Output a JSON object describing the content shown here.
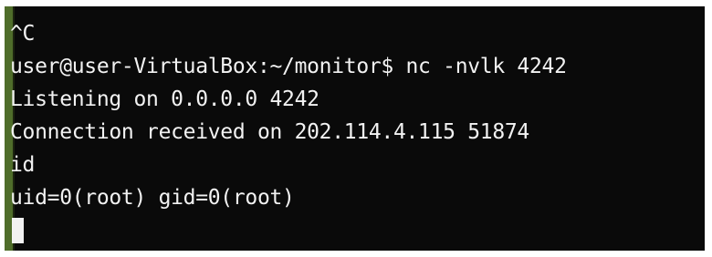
{
  "terminal": {
    "lines": [
      "^C",
      "user@user-VirtualBox:~/monitor$ nc -nvlk 4242",
      "Listening on 0.0.0.0 4242",
      "Connection received on 202.114.4.115 51874",
      "id",
      "uid=0(root) gid=0(root)"
    ],
    "colors": {
      "background": "#0a0a0a",
      "text": "#f2f2f2",
      "left_bar": "#4f6d2a"
    }
  }
}
